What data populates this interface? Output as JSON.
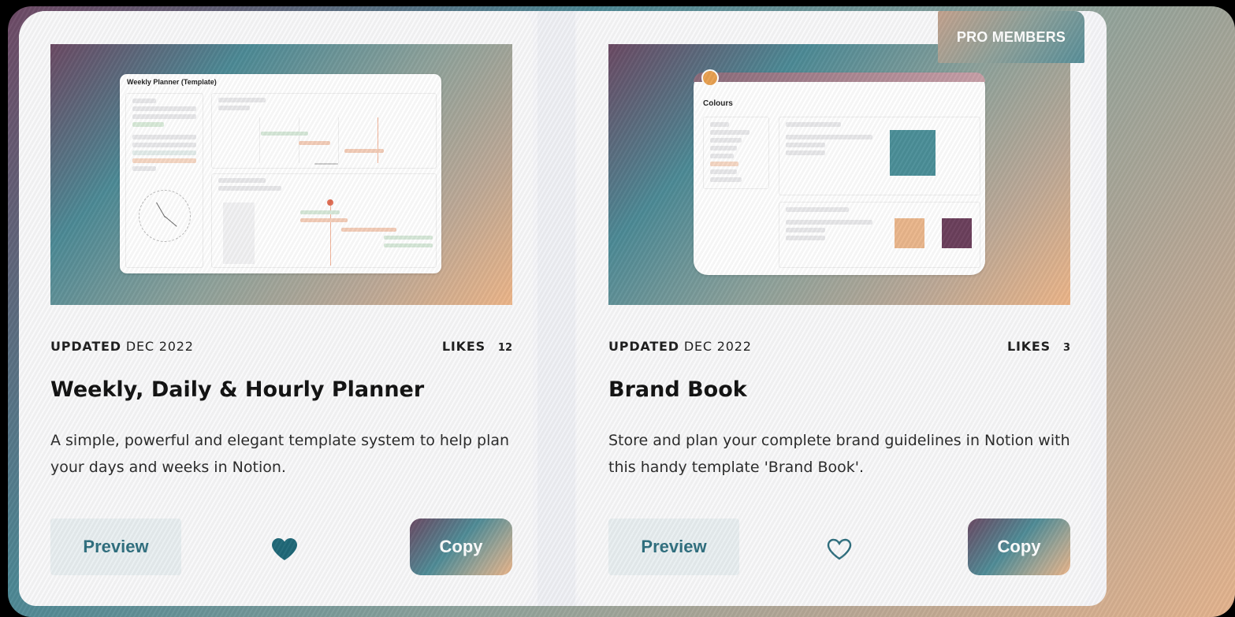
{
  "badge": {
    "pro_members": "PRO MEMBERS"
  },
  "colors": {
    "accent": "#2f6f7f",
    "heart_filled": "#1f6878",
    "heart_outline": "#2f6f7f"
  },
  "cards": [
    {
      "updated_label": "UPDATED",
      "updated_date": "DEC 2022",
      "likes_label": "LIKES",
      "likes_count": "12",
      "title": "Weekly, Daily & Hourly Planner",
      "description": "A simple, powerful and elegant template system to help plan your days and weeks in Notion.",
      "thumbnail_title": "Weekly Planner (Template)",
      "preview_label": "Preview",
      "copy_label": "Copy",
      "liked": true,
      "icon": "heart-filled-icon"
    },
    {
      "updated_label": "UPDATED",
      "updated_date": "DEC 2022",
      "likes_label": "LIKES",
      "likes_count": "3",
      "title": "Brand Book",
      "description": "Store and plan your complete brand guidelines in Notion with this handy template 'Brand Book'.",
      "thumbnail_title": "Colours",
      "preview_label": "Preview",
      "copy_label": "Copy",
      "liked": false,
      "icon": "heart-outline-icon"
    }
  ]
}
